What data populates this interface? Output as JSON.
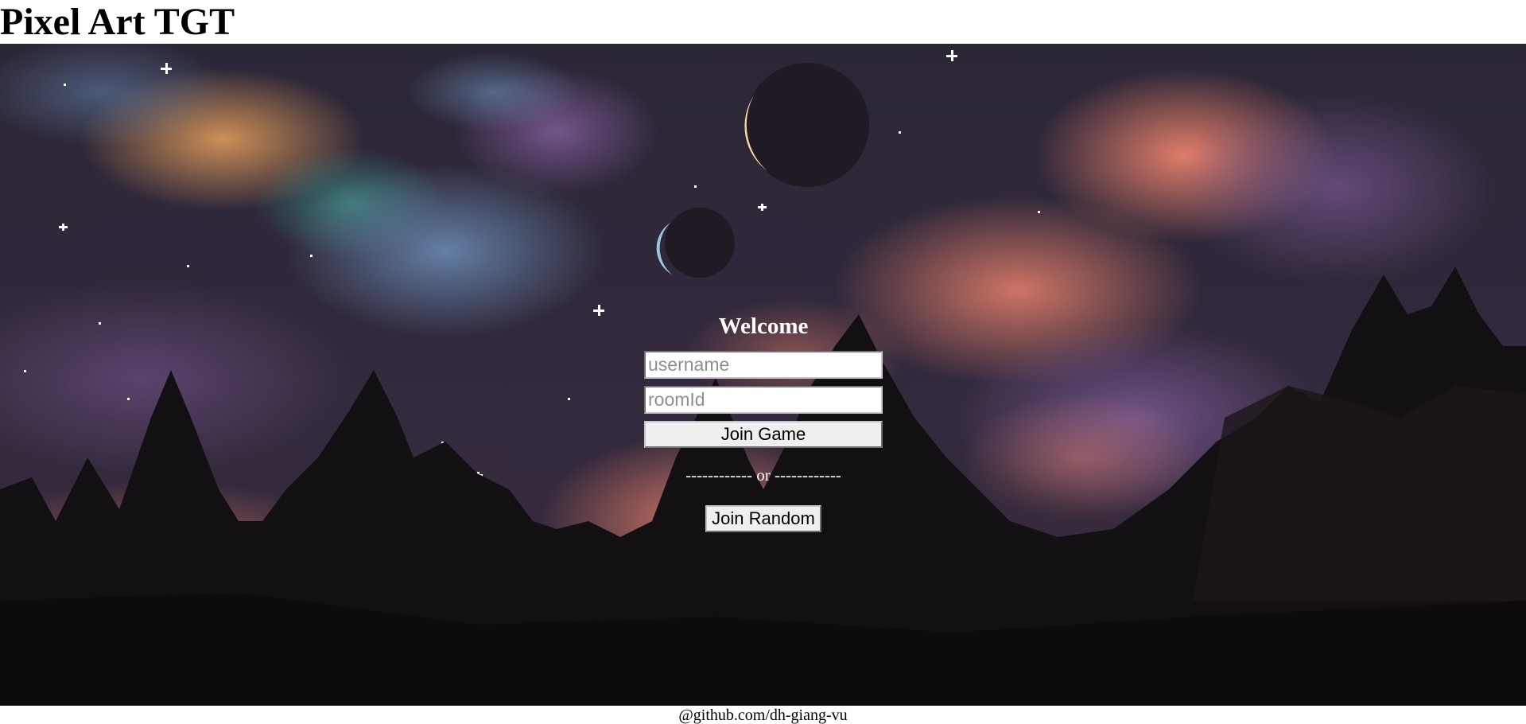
{
  "app": {
    "title": "Pixel Art TGT"
  },
  "login": {
    "heading": "Welcome",
    "username_placeholder": "username",
    "roomid_placeholder": "roomId",
    "join_game_label": "Join Game",
    "divider_text": "------------ or ------------",
    "join_random_label": "Join Random"
  },
  "footer": {
    "text": "@github.com/dh-giang-vu"
  },
  "background": {
    "description_icon": "pixel-night-sky-image",
    "colors": {
      "sky": "#2a2433",
      "cloud_pink": "#e07a6a",
      "cloud_purple": "#6b4a7a",
      "cloud_blue": "#5d7fa3",
      "trees": "#121012"
    }
  }
}
